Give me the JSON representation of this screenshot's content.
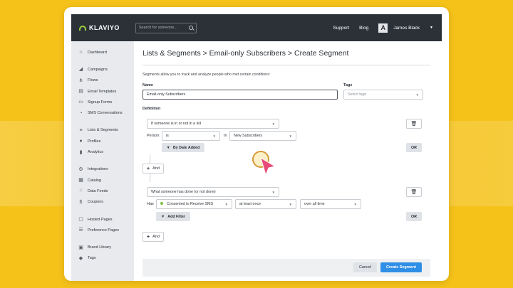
{
  "topbar": {
    "logo_text": "KLAVIYO",
    "search_placeholder": "Search for someone...",
    "support": "Support",
    "blog": "Blog",
    "avatar_letter": "A",
    "user_name": "James Black"
  },
  "sidebar": {
    "groups": [
      [
        {
          "label": "Dashboard",
          "icon": "home-icon"
        }
      ],
      [
        {
          "label": "Campaigns",
          "icon": "megaphone-icon"
        },
        {
          "label": "Flows",
          "icon": "flows-icon"
        },
        {
          "label": "Email Templates",
          "icon": "template-icon"
        },
        {
          "label": "Signup Forms",
          "icon": "form-icon"
        },
        {
          "label": "SMS Conversations",
          "icon": "chat-icon"
        }
      ],
      [
        {
          "label": "Lists & Segments",
          "icon": "list-icon"
        },
        {
          "label": "Profiles",
          "icon": "person-icon"
        },
        {
          "label": "Analytics",
          "icon": "chart-icon"
        }
      ],
      [
        {
          "label": "Integrations",
          "icon": "plug-icon"
        },
        {
          "label": "Catalog",
          "icon": "catalog-icon"
        },
        {
          "label": "Data Feeds",
          "icon": "feed-icon"
        },
        {
          "label": "Coupons",
          "icon": "coupon-icon"
        }
      ],
      [
        {
          "label": "Hosted Pages",
          "icon": "page-icon"
        },
        {
          "label": "Preference Pages",
          "icon": "preference-icon"
        }
      ],
      [
        {
          "label": "Brand Library",
          "icon": "library-icon"
        },
        {
          "label": "Tags",
          "icon": "tag-icon"
        }
      ]
    ]
  },
  "page": {
    "title": "Lists & Segments > Email-only Subscribers > Create Segment",
    "intro": "Segments allow you to track and analyze people who met certain conditions:",
    "name_label": "Name",
    "name_value": "Email-only Subscribers",
    "tags_label": "Tags",
    "tags_placeholder": "Select tags",
    "definition_label": "Definition"
  },
  "condition1": {
    "type": "If someone is in or not in a list",
    "person_label": "Person",
    "operator": "is",
    "in_label": "In",
    "list": "New Subscribers",
    "date_button": "By Date Added",
    "or_button": "OR"
  },
  "and_button": "And",
  "condition2": {
    "type": "What someone has done (or not done)",
    "has_label": "Has",
    "event": "Consented to Receive SMS",
    "frequency": "at least once",
    "timeframe": "over all time",
    "filter_button": "Add Filter",
    "or_button": "OR"
  },
  "footer": {
    "cancel": "Cancel",
    "create": "Create Segment"
  },
  "colors": {
    "background": "#f5c21a",
    "topbar": "#2c3138",
    "primary_button": "#2f8ee5",
    "logo_accent": "#9ad03c",
    "cursor": "#e84a7a"
  }
}
